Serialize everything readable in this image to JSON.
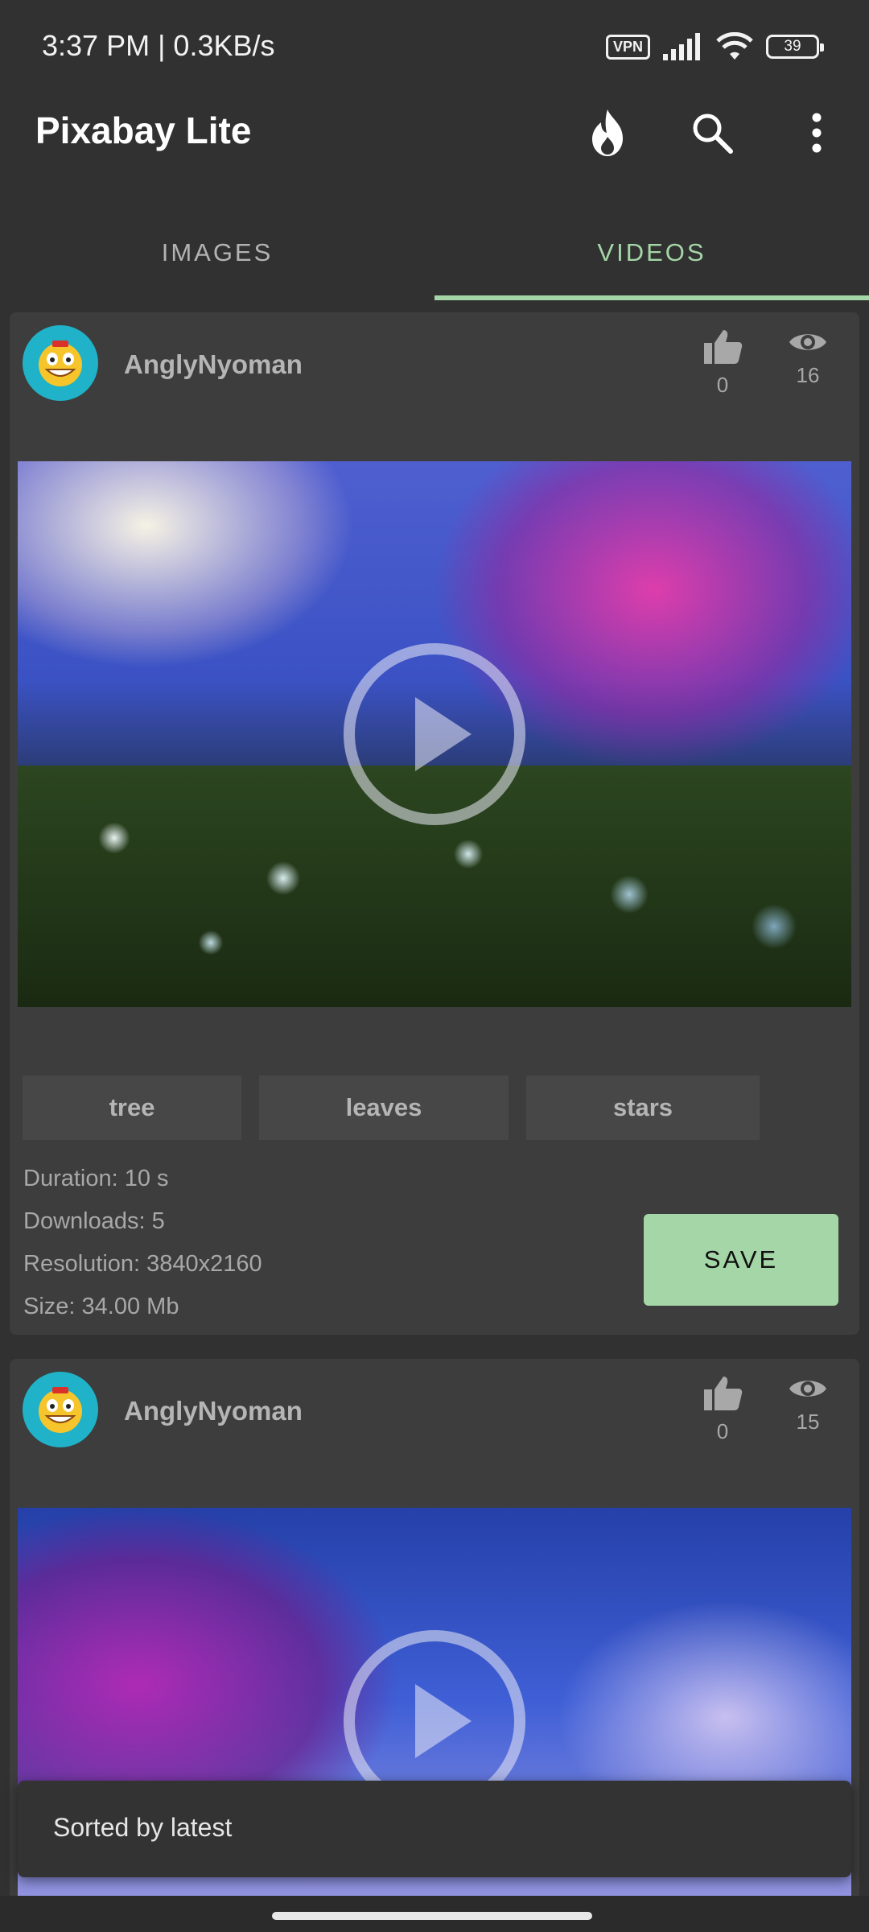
{
  "status_bar": {
    "time": "3:37 PM | 0.3KB/s",
    "vpn_label": "VPN",
    "battery_level": "39"
  },
  "app_bar": {
    "title": "Pixabay Lite",
    "actions": [
      "fire-icon",
      "search-icon",
      "more-vert-icon"
    ]
  },
  "tabs": [
    {
      "label": "IMAGES",
      "active": false
    },
    {
      "label": "VIDEOS",
      "active": true
    }
  ],
  "accent_color": "#a5d6a7",
  "cards": [
    {
      "username": "AnglyNyoman",
      "likes": "0",
      "views": "16",
      "tags": [
        "tree",
        "leaves",
        "stars"
      ],
      "duration": "Duration: 10 s",
      "downloads": "Downloads: 5",
      "resolution": "Resolution: 3840x2160",
      "size": "Size: 34.00 Mb",
      "save_label": "SAVE"
    },
    {
      "username": "AnglyNyoman",
      "likes": "0",
      "views": "15"
    }
  ],
  "snackbar": {
    "message": "Sorted by latest"
  }
}
